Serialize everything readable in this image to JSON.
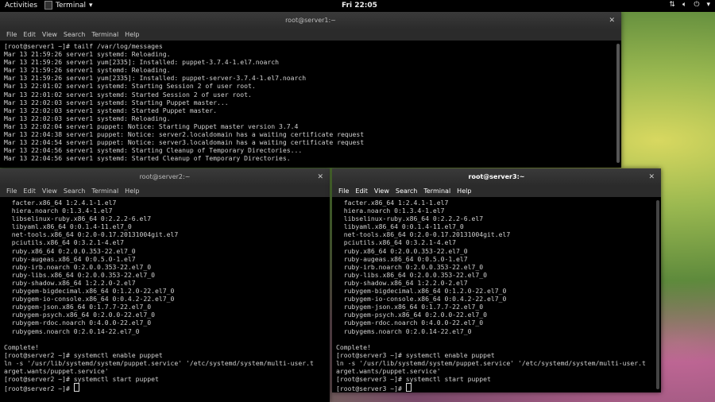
{
  "topbar": {
    "activities": "Activities",
    "app_name": "Terminal",
    "clock": "Fri 22:05"
  },
  "windows": {
    "server1": {
      "title": "root@server1:~",
      "menu": [
        "File",
        "Edit",
        "View",
        "Search",
        "Terminal",
        "Help"
      ],
      "lines": [
        "[root@server1 ~]# tailf /var/log/messages",
        "Mar 13 21:59:26 server1 systemd: Reloading.",
        "Mar 13 21:59:26 server1 yum[2335]: Installed: puppet-3.7.4-1.el7.noarch",
        "Mar 13 21:59:26 server1 systemd: Reloading.",
        "Mar 13 21:59:26 server1 yum[2335]: Installed: puppet-server-3.7.4-1.el7.noarch",
        "Mar 13 22:01:02 server1 systemd: Starting Session 2 of user root.",
        "Mar 13 22:01:02 server1 systemd: Started Session 2 of user root.",
        "Mar 13 22:02:03 server1 systemd: Starting Puppet master...",
        "Mar 13 22:02:03 server1 systemd: Started Puppet master.",
        "Mar 13 22:02:03 server1 systemd: Reloading.",
        "Mar 13 22:02:04 server1 puppet: Notice: Starting Puppet master version 3.7.4",
        "Mar 13 22:04:38 server1 puppet: Notice: server2.localdomain has a waiting certificate request",
        "Mar 13 22:04:54 server1 puppet: Notice: server3.localdomain has a waiting certificate request",
        "Mar 13 22:04:56 server1 systemd: Starting Cleanup of Temporary Directories...",
        "Mar 13 22:04:56 server1 systemd: Started Cleanup of Temporary Directories."
      ]
    },
    "server2": {
      "title": "root@server2:~",
      "menu": [
        "File",
        "Edit",
        "View",
        "Search",
        "Terminal",
        "Help"
      ],
      "lines": [
        "  facter.x86_64 1:2.4.1-1.el7",
        "  hiera.noarch 0:1.3.4-1.el7",
        "  libselinux-ruby.x86_64 0:2.2.2-6.el7",
        "  libyaml.x86_64 0:0.1.4-11.el7_0",
        "  net-tools.x86_64 0:2.0-0.17.20131004git.el7",
        "  pciutils.x86_64 0:3.2.1-4.el7",
        "  ruby.x86_64 0:2.0.0.353-22.el7_0",
        "  ruby-augeas.x86_64 0:0.5.0-1.el7",
        "  ruby-irb.noarch 0:2.0.0.353-22.el7_0",
        "  ruby-libs.x86_64 0:2.0.0.353-22.el7_0",
        "  ruby-shadow.x86_64 1:2.2.0-2.el7",
        "  rubygem-bigdecimal.x86_64 0:1.2.0-22.el7_0",
        "  rubygem-io-console.x86_64 0:0.4.2-22.el7_0",
        "  rubygem-json.x86_64 0:1.7.7-22.el7_0",
        "  rubygem-psych.x86_64 0:2.0.0-22.el7_0",
        "  rubygem-rdoc.noarch 0:4.0.0-22.el7_0",
        "  rubygems.noarch 0:2.0.14-22.el7_0",
        "",
        "Complete!",
        "[root@server2 ~]# systemctl enable puppet",
        "ln -s '/usr/lib/systemd/system/puppet.service' '/etc/systemd/system/multi-user.t",
        "arget.wants/puppet.service'",
        "[root@server2 ~]# systemctl start puppet",
        "[root@server2 ~]# "
      ]
    },
    "server3": {
      "title": "root@server3:~",
      "menu": [
        "File",
        "Edit",
        "View",
        "Search",
        "Terminal",
        "Help"
      ],
      "lines": [
        "  facter.x86_64 1:2.4.1-1.el7",
        "  hiera.noarch 0:1.3.4-1.el7",
        "  libselinux-ruby.x86_64 0:2.2.2-6.el7",
        "  libyaml.x86_64 0:0.1.4-11.el7_0",
        "  net-tools.x86_64 0:2.0-0.17.20131004git.el7",
        "  pciutils.x86_64 0:3.2.1-4.el7",
        "  ruby.x86_64 0:2.0.0.353-22.el7_0",
        "  ruby-augeas.x86_64 0:0.5.0-1.el7",
        "  ruby-irb.noarch 0:2.0.0.353-22.el7_0",
        "  ruby-libs.x86_64 0:2.0.0.353-22.el7_0",
        "  ruby-shadow.x86_64 1:2.2.0-2.el7",
        "  rubygem-bigdecimal.x86_64 0:1.2.0-22.el7_0",
        "  rubygem-io-console.x86_64 0:0.4.2-22.el7_0",
        "  rubygem-json.x86_64 0:1.7.7-22.el7_0",
        "  rubygem-psych.x86_64 0:2.0.0-22.el7_0",
        "  rubygem-rdoc.noarch 0:4.0.0-22.el7_0",
        "  rubygems.noarch 0:2.0.14-22.el7_0",
        "",
        "Complete!",
        "[root@server3 ~]# systemctl enable puppet",
        "ln -s '/usr/lib/systemd/system/puppet.service' '/etc/systemd/system/multi-user.t",
        "arget.wants/puppet.service'",
        "[root@server3 ~]# systemctl start puppet",
        "[root@server3 ~]# "
      ]
    }
  },
  "icons": {
    "close": "close-icon",
    "network": "network-icon",
    "volume": "volume-icon",
    "power": "power-icon"
  }
}
